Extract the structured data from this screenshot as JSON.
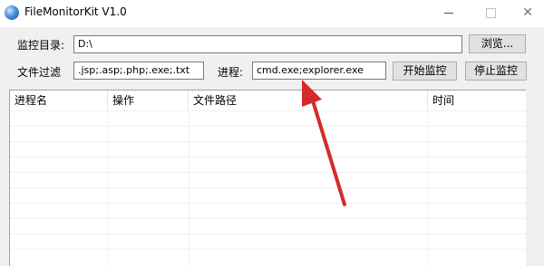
{
  "window": {
    "title": "FileMonitorKit V1.0",
    "icons": {
      "app": "globe-icon",
      "minimize": "minimize-icon",
      "maximize": "maximize-icon",
      "close": "close-icon"
    },
    "close_glyph": "✕"
  },
  "form": {
    "monitor_dir_label": "监控目录:",
    "monitor_dir_value": "D:\\",
    "browse_button": "浏览...",
    "file_filter_label": "文件过滤",
    "file_filter_value": ".jsp;.asp;.php;.exe;.txt",
    "process_label": "进程:",
    "process_value": "cmd.exe;explorer.exe",
    "start_button": "开始监控",
    "stop_button": "停止监控"
  },
  "list": {
    "columns": [
      "进程名",
      "操作",
      "文件路径",
      "时间"
    ],
    "rows": []
  },
  "annotation": {
    "arrow_color": "#d42a2a"
  }
}
